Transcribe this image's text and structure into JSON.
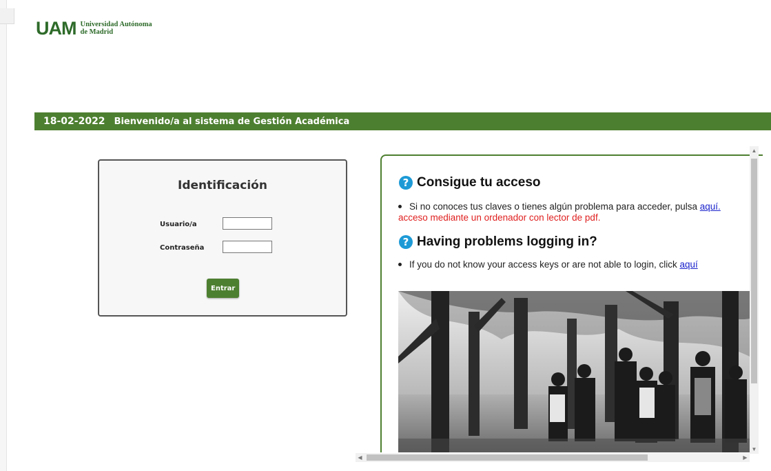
{
  "logo": {
    "mark": "UAM",
    "name_line1": "Universidad Autónoma",
    "name_line2": "de Madrid"
  },
  "banner": {
    "date": "18-02-2022",
    "welcome": "Bienvenido/a al sistema de Gestión Académica"
  },
  "login": {
    "title": "Identificación",
    "user_label": "Usuario/a",
    "user_value": "",
    "password_label": "Contraseña",
    "password_value": "",
    "submit_label": "Entrar"
  },
  "info": {
    "es_heading": "Consigue tu acceso",
    "es_text": "Si no conoces tus claves o tienes algún problema para acceder, pulsa ",
    "es_link": "aquí.",
    "es_note": "acceso mediante un ordenador con lector de pdf.",
    "en_heading": "Having problems logging in?",
    "en_text": "If you do not know your access keys or are not able to login, click ",
    "en_link": "aquí",
    "help_icon_glyph": "?"
  },
  "colors": {
    "brand_green": "#4d7f30",
    "help_blue": "#1d9ad6",
    "link_blue": "#1a22cc",
    "note_red": "#e02020"
  }
}
